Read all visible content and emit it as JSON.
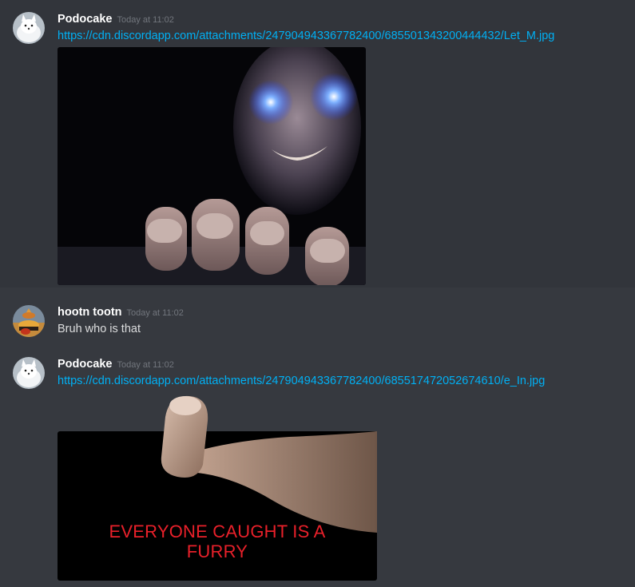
{
  "messages": [
    {
      "author": "Podocake",
      "timestamp": "Today at 11:02",
      "link": "https://cdn.discordapp.com/attachments/247904943367782400/685501343200444432/Let_M.jpg"
    },
    {
      "author": "hootn tootn",
      "timestamp": "Today at 11:02",
      "text": "Bruh who is that"
    },
    {
      "author": "Podocake",
      "timestamp": "Today at 11:02",
      "link": "https://cdn.discordapp.com/attachments/247904943367782400/685517472052674610/e_In.jpg",
      "image_caption_line1": "EVERYONE CAUGHT IS A",
      "image_caption_line2": "FURRY"
    }
  ],
  "colors": {
    "background": "#36393f",
    "username": "#ffffff",
    "timestamp": "#72767d",
    "link": "#00b0f4",
    "text": "#dcddde",
    "caption": "#e8202a"
  }
}
